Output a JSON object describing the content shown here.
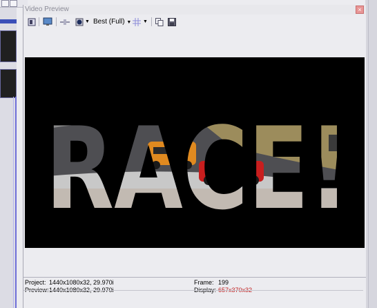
{
  "window": {
    "title": "Video Preview",
    "close_glyph": "×"
  },
  "toolbar": {
    "quality_label": "Best (Full)"
  },
  "video": {
    "text": "RACE!"
  },
  "status": {
    "project_label": "Project:",
    "project_value": "1440x1080x32, 29.970i",
    "preview_label": "Preview:",
    "preview_value": "1440x1080x32, 29.970i",
    "frame_label": "Frame:",
    "frame_value": "199",
    "display_label": "Display:",
    "display_value": "657x370x32"
  },
  "colors": {
    "display_value": "#c02020",
    "timeline_accent": "#3b4fb8"
  },
  "icons": [
    "video-output-icon",
    "monitor-icon",
    "split-screen-icon",
    "overlays-icon",
    "quality-dropdown-icon",
    "grid-icon",
    "copy-snapshot-icon",
    "save-snapshot-icon"
  ]
}
